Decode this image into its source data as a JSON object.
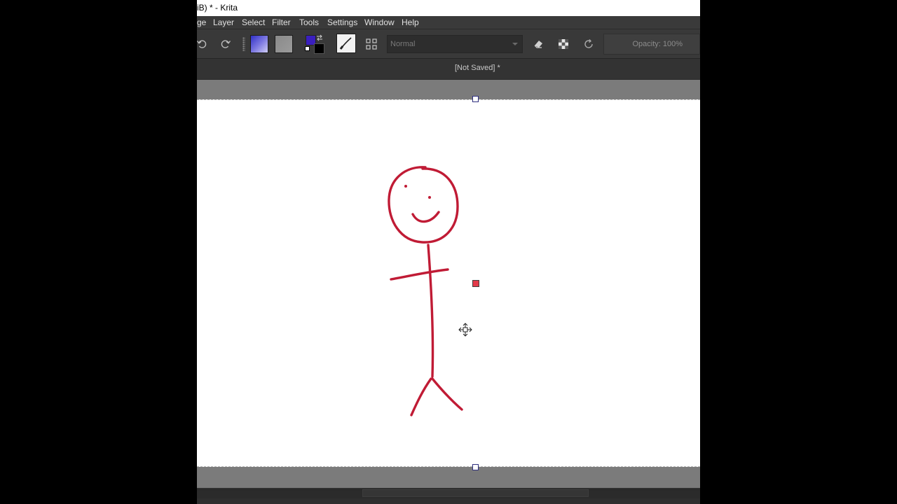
{
  "window": {
    "title": "iB)  * - Krita"
  },
  "menubar": {
    "items": [
      {
        "label": "ge",
        "accel": ""
      },
      {
        "label": "Layer",
        "accel": "L"
      },
      {
        "label": "Select",
        "accel": "S"
      },
      {
        "label": "Filter",
        "accel": "F"
      },
      {
        "label": "Tools",
        "accel": "T"
      },
      {
        "label": "Settings",
        "accel": "S"
      },
      {
        "label": "Window",
        "accel": "W"
      },
      {
        "label": "Help",
        "accel": "H"
      }
    ]
  },
  "toolbar": {
    "undo_icon": "undo-icon",
    "redo_icon": "redo-icon",
    "fill_gradient": "gradient-swatch",
    "fill_pattern": "pattern-swatch",
    "foreground_color": "#3a1fbf",
    "background_color": "#000000",
    "brush_preset_icon": "brush-preset-icon",
    "brush_settings_icon": "brush-settings-icon",
    "blend_mode": "Normal",
    "eraser_icon": "eraser-icon",
    "alpha_lock_icon": "alpha-lock-icon",
    "reload_icon": "reload-icon",
    "opacity_label": "Opacity: 100%"
  },
  "document": {
    "tab_title": "[Not Saved]  *",
    "stroke_color": "#c01b35"
  },
  "canvas": {
    "cursor_icon": "move-cursor-icon",
    "transform_center_color": "#e23a4a"
  }
}
